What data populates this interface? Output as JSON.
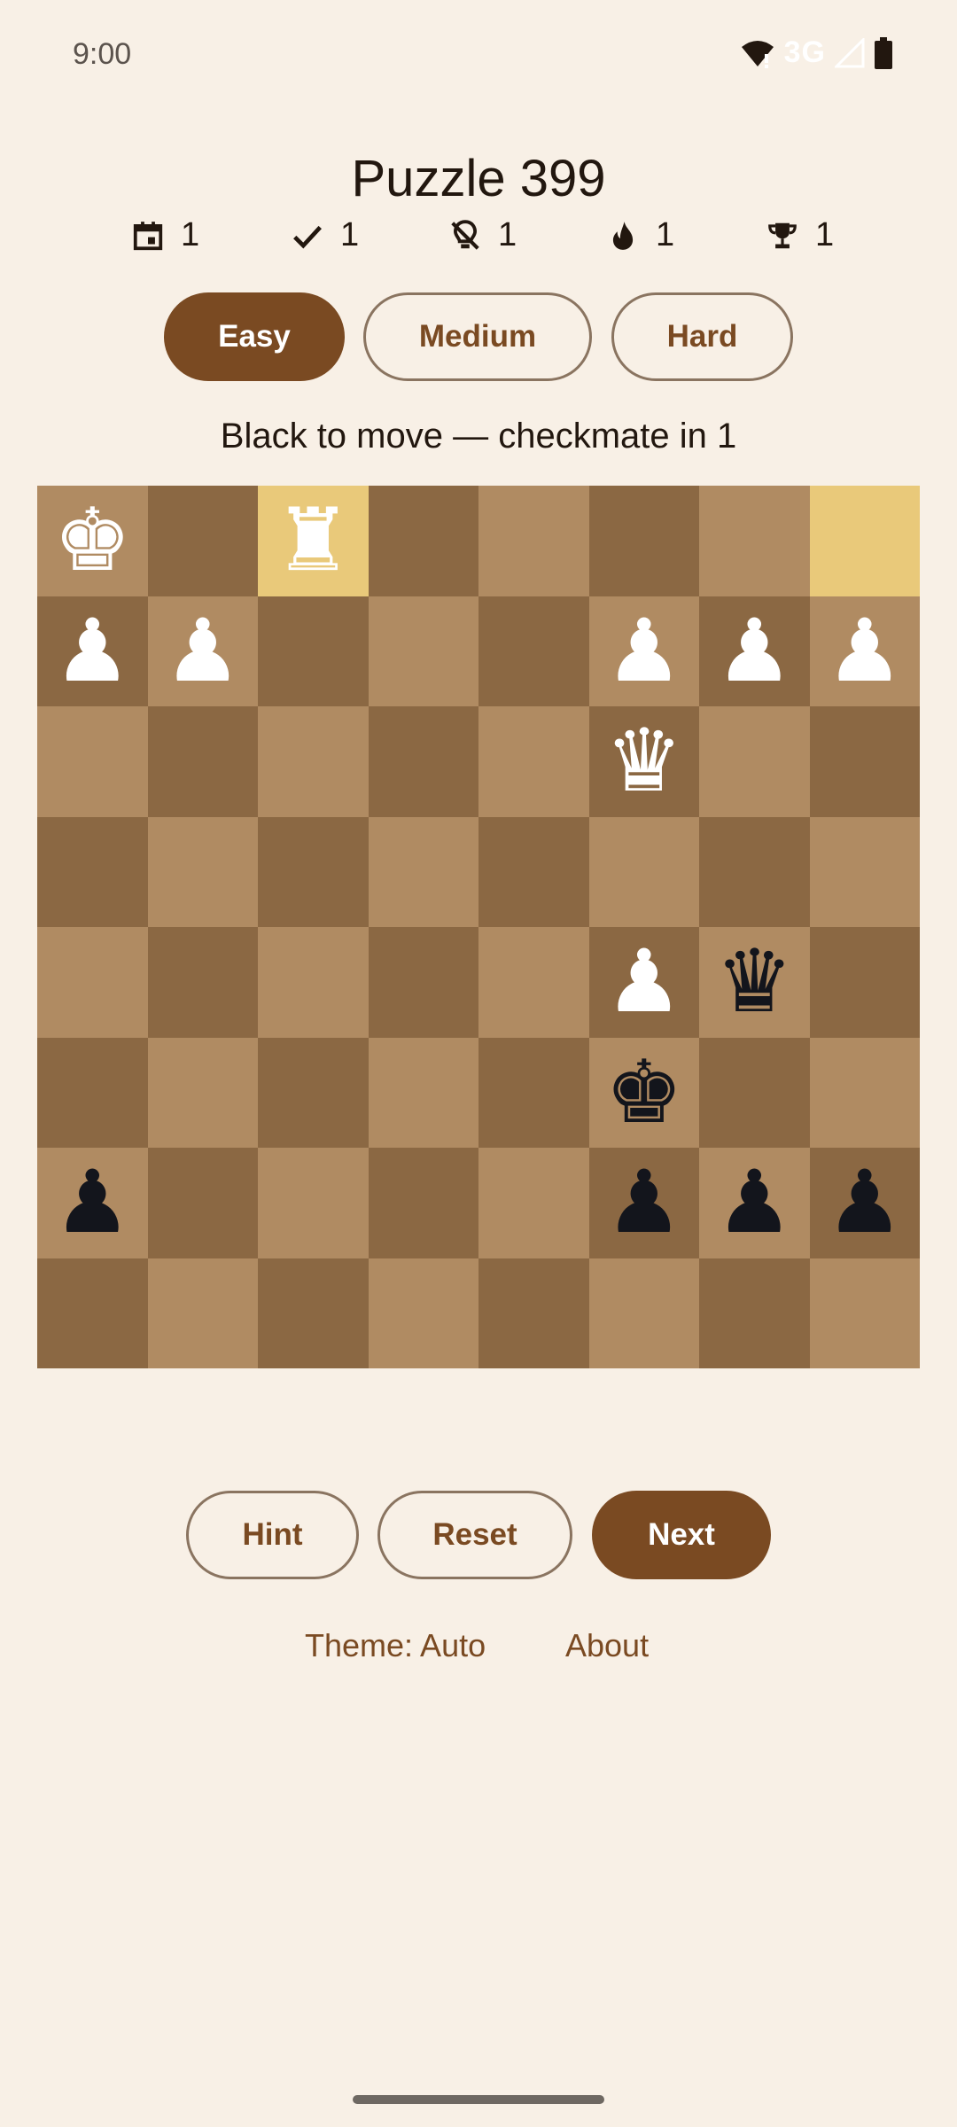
{
  "status": {
    "time": "9:00",
    "network": "3G"
  },
  "title": "Puzzle 399",
  "stats": [
    {
      "icon": "calendar-icon",
      "value": "1"
    },
    {
      "icon": "check-icon",
      "value": "1"
    },
    {
      "icon": "no-bulb-icon",
      "value": "1"
    },
    {
      "icon": "flame-icon",
      "value": "1"
    },
    {
      "icon": "trophy-icon",
      "value": "1"
    }
  ],
  "difficulty": {
    "easy": "Easy",
    "medium": "Medium",
    "hard": "Hard",
    "selected": "Easy"
  },
  "prompt": "Black to move — checkmate in 1",
  "board": {
    "light_color": "#B08B62",
    "dark_color": "#8B6843",
    "highlight_color": "#E9C97A",
    "highlighted": [
      "c8",
      "h8"
    ],
    "ranks": [
      "K.R.....",
      "PP...PPP",
      ".....Q..",
      "........",
      ".....Pq.",
      ".....k..",
      "p....ppp",
      "........"
    ]
  },
  "controls": {
    "hint": "Hint",
    "reset": "Reset",
    "next": "Next"
  },
  "footer": {
    "theme": "Theme: Auto",
    "about": "About"
  },
  "colors": {
    "accent": "#7A4A22",
    "background": "#F8F0E6"
  }
}
